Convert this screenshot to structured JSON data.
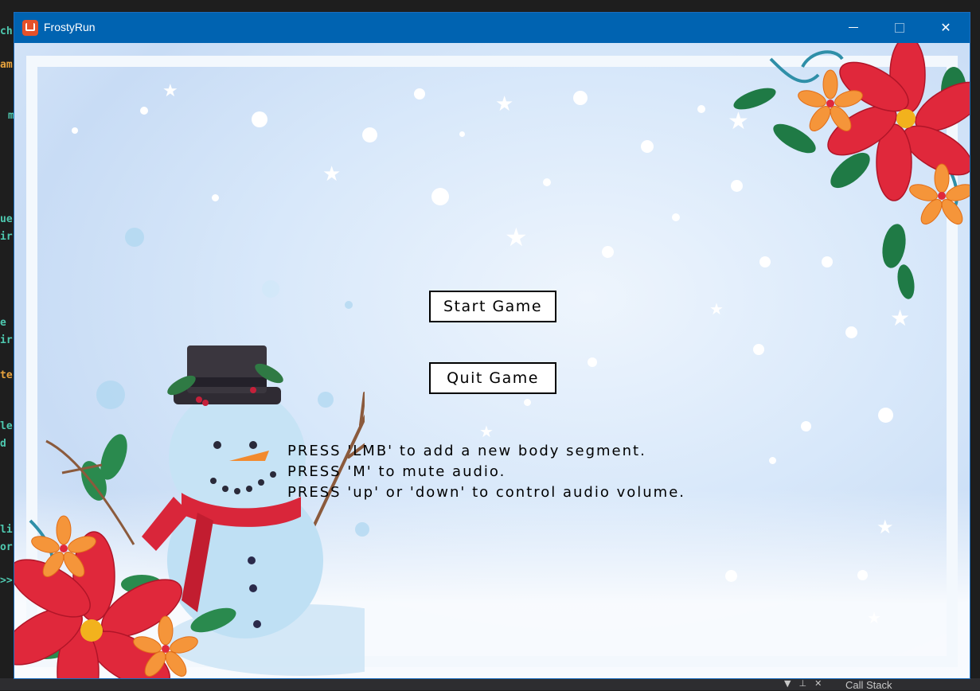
{
  "window": {
    "title": "FrostyRun",
    "controls": {
      "minimize": "minimize",
      "maximize": "maximize",
      "close": "close"
    }
  },
  "menu": {
    "start_label": "Start Game",
    "quit_label": "Quit Game"
  },
  "instructions": [
    "PRESS 'LMB' to add a new body segment.",
    "PRESS 'M' to mute audio.",
    "PRESS 'up' or 'down' to control audio volume."
  ],
  "ide_background": {
    "call_stack_label": "Call Stack",
    "fragments": [
      "ch",
      "am",
      "m",
      "ue",
      "ir",
      "e",
      "ir",
      "ter",
      "le",
      "d",
      "li",
      "or",
      ">>"
    ]
  },
  "colors": {
    "titlebar": "#0063b1",
    "button_border": "#000000",
    "poinsettia_red": "#e0283b",
    "scarf_red": "#d9263a",
    "hat": "#2f2b33",
    "snowman": "#bfe0f4"
  },
  "icons": [
    "app-icon",
    "minimize-icon",
    "maximize-icon",
    "close-icon"
  ]
}
